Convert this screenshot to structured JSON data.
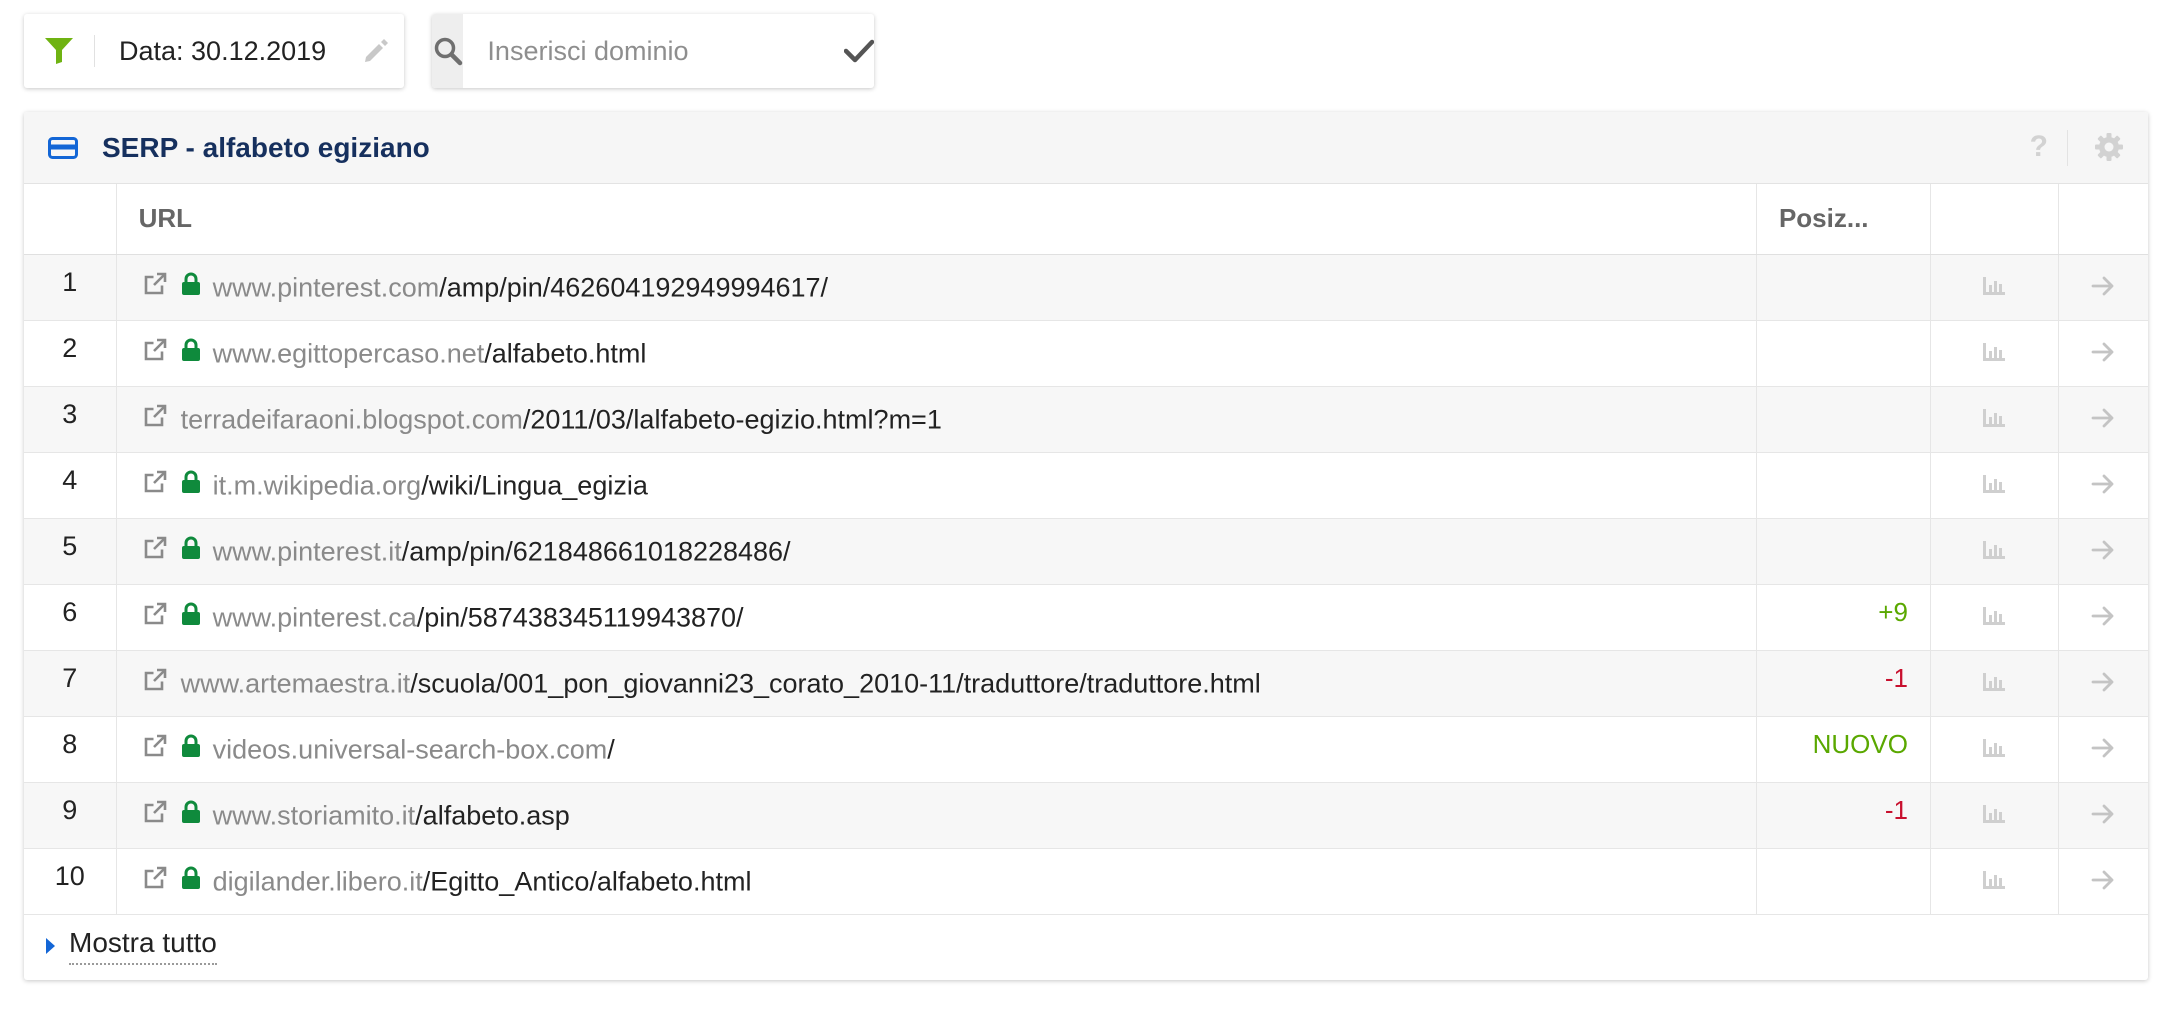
{
  "date_filter": {
    "label": "Data: 30.12.2019",
    "icon": "filter-icon",
    "edit_icon": "pencil-icon"
  },
  "domain_search": {
    "placeholder": "Inserisci dominio",
    "search_icon": "search-icon",
    "confirm_icon": "check-icon"
  },
  "panel": {
    "title": "SERP - alfabeto egiziano",
    "help_label": "?",
    "settings_icon": "gear-icon",
    "columns": {
      "index": "",
      "url": "URL",
      "position": "Posiz..."
    },
    "rows": [
      {
        "num": "1",
        "domain": "www.pinterest.com",
        "path": "/amp/pin/462604192949994617/",
        "secure": true,
        "change": ""
      },
      {
        "num": "2",
        "domain": "www.egittopercaso.net",
        "path": "/alfabeto.html",
        "secure": true,
        "change": ""
      },
      {
        "num": "3",
        "domain": "terradeifaraoni.blogspot.com",
        "path": "/2011/03/lalfabeto-egizio.html?m=1",
        "secure": false,
        "change": ""
      },
      {
        "num": "4",
        "domain": "it.m.wikipedia.org",
        "path": "/wiki/Lingua_egizia",
        "secure": true,
        "change": ""
      },
      {
        "num": "5",
        "domain": "www.pinterest.it",
        "path": "/amp/pin/621848661018228486/",
        "secure": true,
        "change": ""
      },
      {
        "num": "6",
        "domain": "www.pinterest.ca",
        "path": "/pin/587438345119943870/",
        "secure": true,
        "change": "+9"
      },
      {
        "num": "7",
        "domain": "www.artemaestra.it",
        "path": "/scuola/001_pon_giovanni23_corato_2010-11/traduttore/traduttore.html",
        "secure": false,
        "change": "-1"
      },
      {
        "num": "8",
        "domain": "videos.universal-search-box.com",
        "path": "/",
        "secure": true,
        "change": "NUOVO"
      },
      {
        "num": "9",
        "domain": "www.storiamito.it",
        "path": "/alfabeto.asp",
        "secure": true,
        "change": "-1"
      },
      {
        "num": "10",
        "domain": "digilander.libero.it",
        "path": "/Egitto_Antico/alfabeto.html",
        "secure": true,
        "change": ""
      }
    ],
    "show_all_label": "Mostra tutto"
  },
  "colors": {
    "accent_blue": "#1366d6",
    "title_navy": "#16305e",
    "filter_green": "#6fb312",
    "lock_green": "#0f8a3c",
    "positive": "#5aa800",
    "negative": "#c8102e"
  }
}
